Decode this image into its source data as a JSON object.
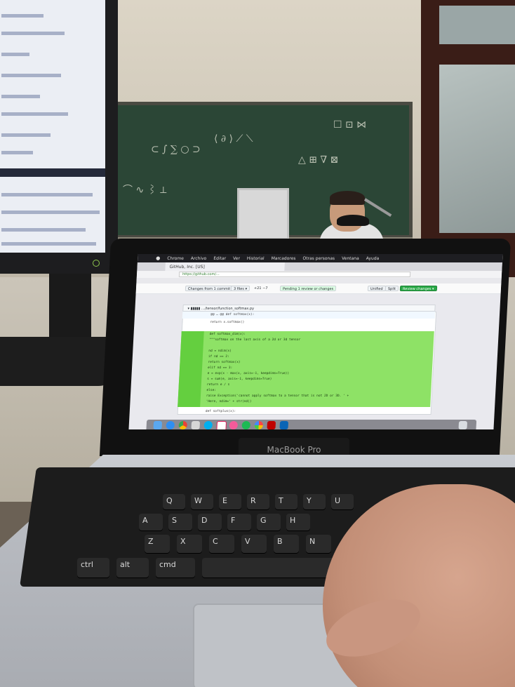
{
  "menubar": {
    "app": "Chrome",
    "items": [
      "Archivo",
      "Editar",
      "Ver",
      "Historial",
      "Marcadores",
      "Otras personas",
      "Ventana",
      "Ayuda"
    ]
  },
  "browser": {
    "tab_title": "GitHub, Inc. [US]",
    "url": "https://github.com/..."
  },
  "github": {
    "toolbar": {
      "changes_from": "Changes from 1 commit ▾",
      "files": "3 files ▾",
      "diffstat": "+21 −7",
      "pending": "Pending 1 review or changes",
      "unified": "Unified",
      "split": "Split",
      "review_changes": "Review changes ▾"
    },
    "file_header": "▾ ▮▮▮▮▮ …/tensor/function_softmax.py",
    "hunk_header": "@@ … @@ def softmax(x):",
    "code_context": [
      "return x.softmax()",
      ""
    ],
    "code_added": [
      "def softmax_dim(x):",
      "    \"\"\"softmax on the last axis of a 2d or 3d tensor",
      "",
      "    nd = ndim(x)",
      "    if nd == 2:",
      "        return softmax(x)",
      "    elif nd == 3:",
      "        e = exp(x - max(x, axis=-1, keepdims=True))",
      "        s = sum(e, axis=-1, keepdims=True)",
      "        return e / s",
      "    else:",
      "        raise Exception('cannot apply softmax to a tensor that is not 2D or 3D. ' +",
      "                        'Here, ndim=' + str(nd))"
    ],
    "code_after": "def softplus(x):"
  },
  "laptop": {
    "badge": "MacBook Pro"
  },
  "keyboard": {
    "row1": [
      "Q",
      "W",
      "E",
      "R",
      "T",
      "Y",
      "U"
    ],
    "row2": [
      "A",
      "S",
      "D",
      "F",
      "G",
      "H"
    ],
    "row3": [
      "Z",
      "X",
      "C",
      "V",
      "B",
      "N"
    ],
    "mods": [
      "ctrl",
      "alt",
      "cmd"
    ]
  },
  "colors": {
    "diff_added": "#8ee266",
    "diff_gutter": "#64cf3f",
    "chalkboard": "#2b4636",
    "review_button": "#28a745"
  },
  "icons": {
    "apple": "apple-icon",
    "dock": [
      "finder-icon",
      "app-store-icon",
      "chrome-icon",
      "script-editor-icon",
      "skype-icon",
      "slack-icon",
      "itunes-icon",
      "spotify-icon",
      "photos-icon",
      "filezilla-icon",
      "outlook-icon",
      "trash-icon"
    ]
  }
}
